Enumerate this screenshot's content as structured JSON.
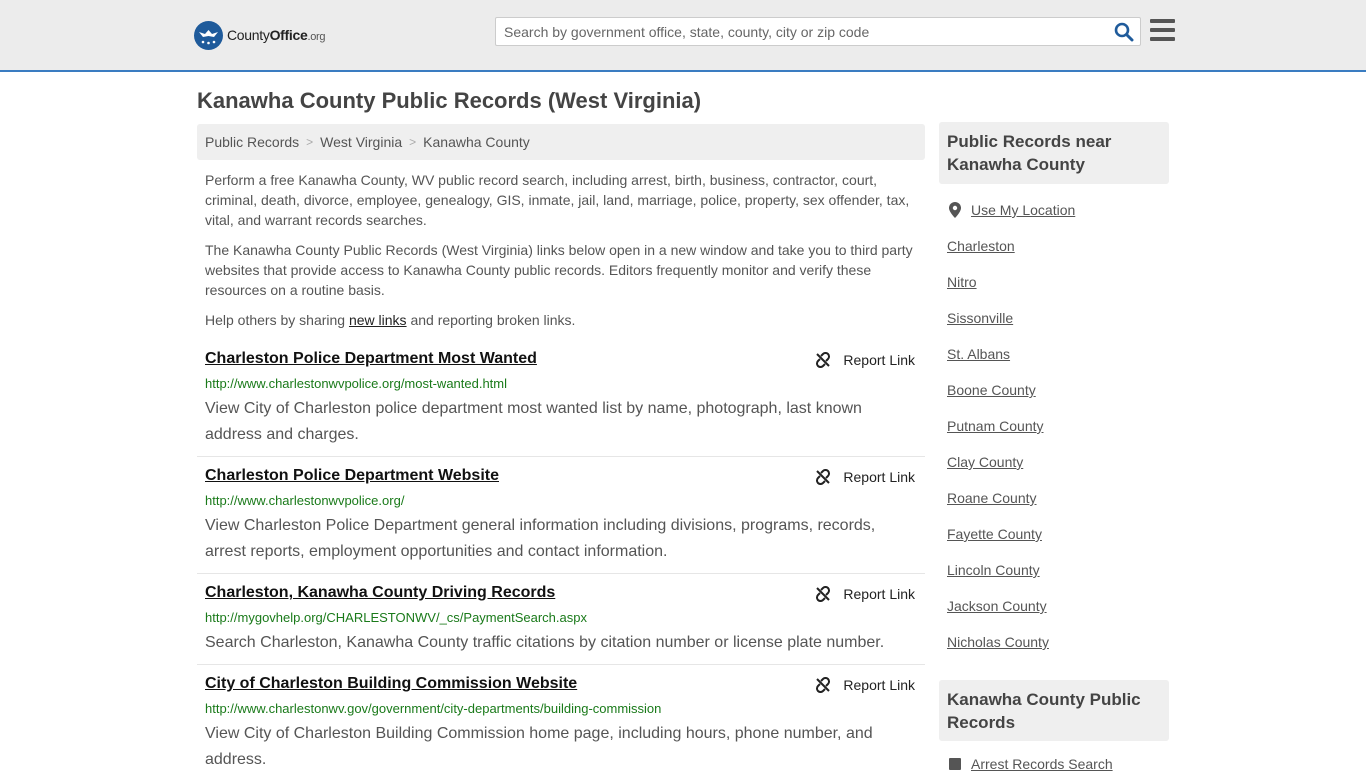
{
  "header": {
    "logo_name": "County",
    "logo_name_bold": "Office",
    "logo_suffix": ".org",
    "search_placeholder": "Search by government office, state, county, city or zip code"
  },
  "page_title": "Kanawha County Public Records (West Virginia)",
  "breadcrumb": [
    "Public Records",
    "West Virginia",
    "Kanawha County"
  ],
  "intro": {
    "p1": "Perform a free Kanawha County, WV public record search, including arrest, birth, business, contractor, court, criminal, death, divorce, employee, genealogy, GIS, inmate, jail, land, marriage, police, property, sex offender, tax, vital, and warrant records searches.",
    "p2": "The Kanawha County Public Records (West Virginia) links below open in a new window and take you to third party websites that provide access to Kanawha County public records. Editors frequently monitor and verify these resources on a routine basis.",
    "p3_before": "Help others by sharing ",
    "p3_link": "new links",
    "p3_after": " and reporting broken links."
  },
  "report_label": "Report Link",
  "results": [
    {
      "title": "Charleston Police Department Most Wanted",
      "url": "http://www.charlestonwvpolice.org/most-wanted.html",
      "desc": "View City of Charleston police department most wanted list by name, photograph, last known address and charges."
    },
    {
      "title": "Charleston Police Department Website",
      "url": "http://www.charlestonwvpolice.org/",
      "desc": "View Charleston Police Department general information including divisions, programs, records, arrest reports, employment opportunities and contact information."
    },
    {
      "title": "Charleston, Kanawha County Driving Records",
      "url": "http://mygovhelp.org/CHARLESTONWV/_cs/PaymentSearch.aspx",
      "desc": "Search Charleston, Kanawha County traffic citations by citation number or license plate number."
    },
    {
      "title": "City of Charleston Building Commission Website",
      "url": "http://www.charlestonwv.gov/government/city-departments/building-commission",
      "desc": "View City of Charleston Building Commission home page, including hours, phone number, and address."
    }
  ],
  "sidebar": {
    "near_heading": "Public Records near Kanawha County",
    "use_location": "Use My Location",
    "places": [
      "Charleston",
      "Nitro",
      "Sissonville",
      "St. Albans",
      "Boone County",
      "Putnam County",
      "Clay County",
      "Roane County",
      "Fayette County",
      "Lincoln County",
      "Jackson County",
      "Nicholas County"
    ],
    "county_heading": "Kanawha County Public Records",
    "county_links": [
      "Arrest Records Search"
    ]
  }
}
